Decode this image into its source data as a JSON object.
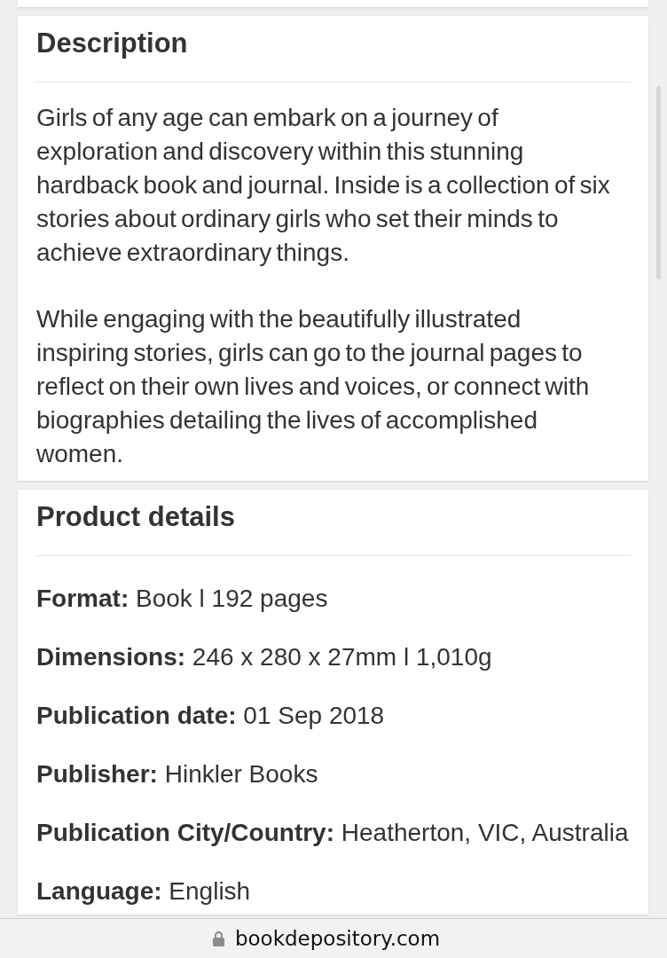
{
  "description": {
    "title": "Description",
    "paragraphs": [
      "Girls of any age can embark on a journey of exploration and discovery within this stunning hardback book and journal. Inside is a collection of six stories about ordinary girls who set their minds to achieve extraordinary things.",
      "While engaging with the beautifully illustrated inspiring stories, girls can go to the journal pages to reflect on their own lives and voices, or connect with biographies detailing the lives of accomplished women."
    ]
  },
  "product_details": {
    "title": "Product details",
    "rows": [
      {
        "label": "Format:",
        "value": "Book l 192 pages"
      },
      {
        "label": "Dimensions:",
        "value": "246 x 280 x 27mm l 1,010g"
      },
      {
        "label": "Publication date:",
        "value": "01 Sep 2018"
      },
      {
        "label": "Publisher:",
        "value": "Hinkler Books"
      },
      {
        "label": "Publication City/Country:",
        "value": "Heatherton, VIC, Australia"
      },
      {
        "label": "Language:",
        "value": "English"
      }
    ]
  },
  "address_bar": {
    "url": "bookdepository.com"
  }
}
